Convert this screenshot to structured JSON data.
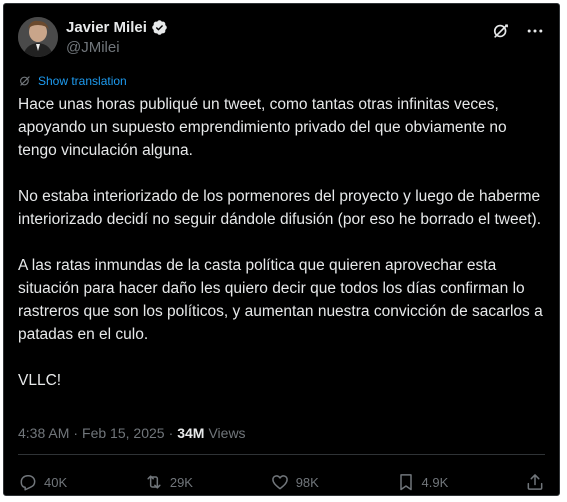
{
  "author": {
    "display_name": "Javier Milei",
    "handle": "@JMilei"
  },
  "translate_label": "Show translation",
  "body": {
    "p1": "Hace unas horas publiqué un tweet, como tantas otras infinitas veces, apoyando un supuesto emprendimiento privado del que obviamente no tengo vinculación alguna.",
    "p2": "No estaba interiorizado de los pormenores del proyecto y luego de haberme interiorizado decidí no seguir dándole difusión (por eso he borrado el tweet).",
    "p3": "A las ratas inmundas de la casta política que quieren aprovechar esta situación para hacer daño les quiero decir que todos los días confirman lo rastreros que son los políticos, y aumentan nuestra convicción de sacarlos a patadas en el culo.",
    "p4": "VLLC!"
  },
  "meta": {
    "time": "4:38 AM",
    "date": "Feb 15, 2025",
    "views_count": "34M",
    "views_label": "Views"
  },
  "actions": {
    "replies": "40K",
    "reposts": "29K",
    "likes": "98K",
    "bookmarks": "4.9K"
  },
  "colors": {
    "background": "#000000",
    "text": "#e7e9ea",
    "muted": "#71767b",
    "link": "#1d9bf0"
  }
}
